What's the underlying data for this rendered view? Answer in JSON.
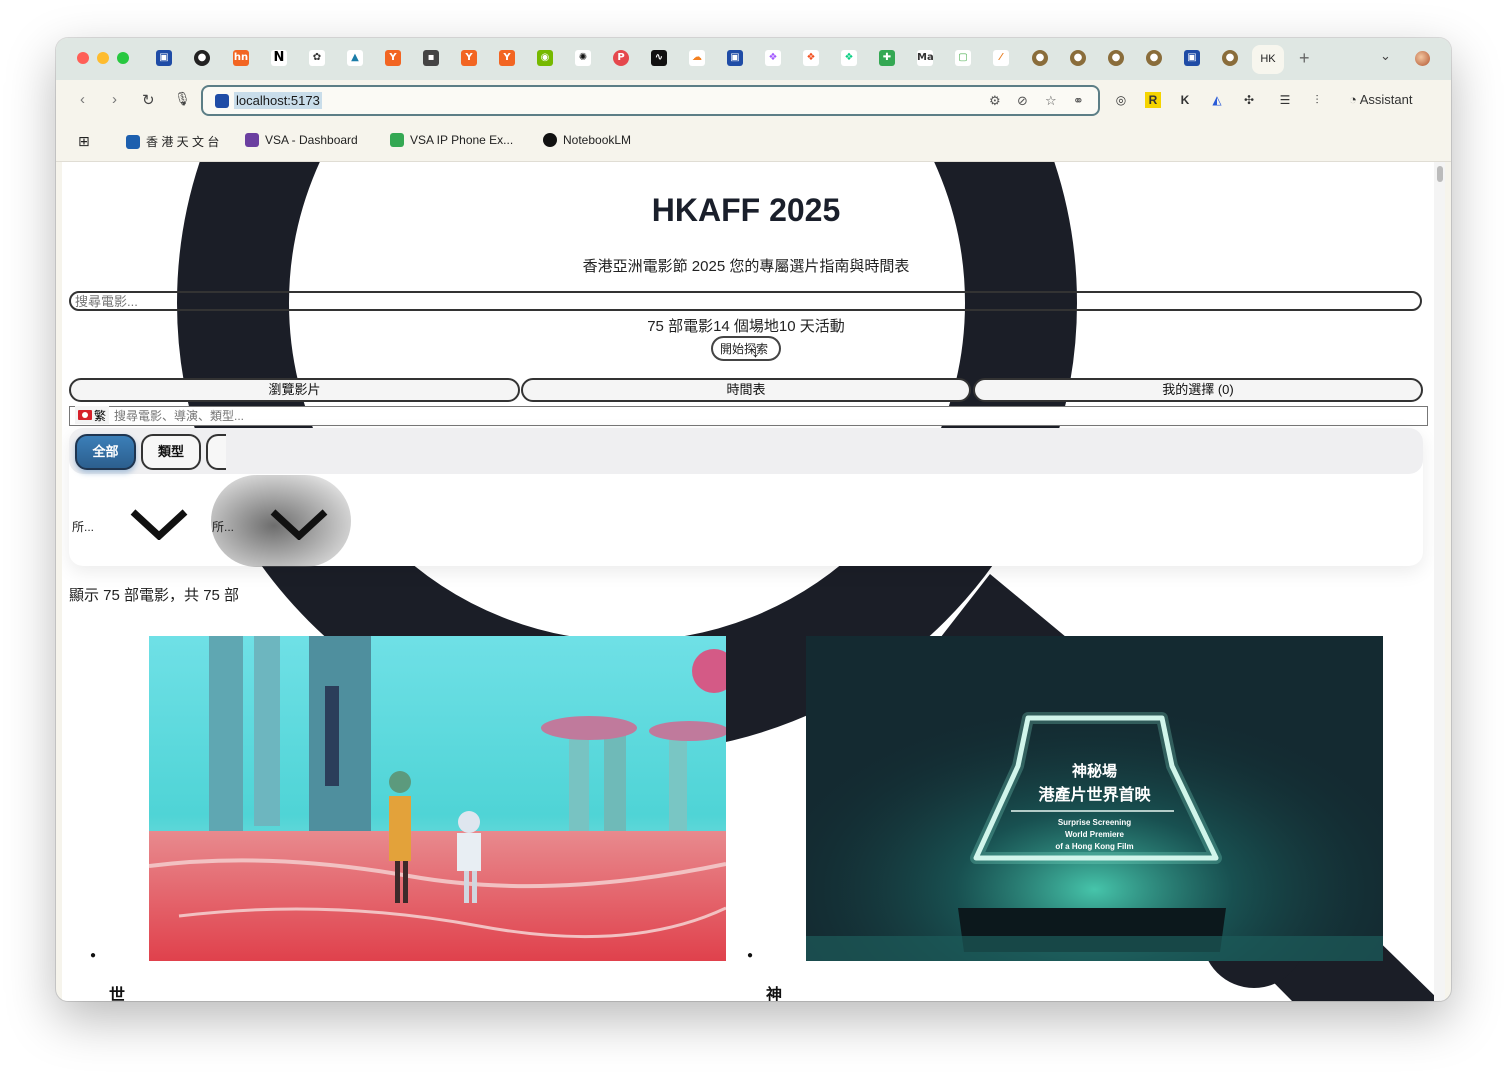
{
  "browser": {
    "active_tab_label": "HK",
    "url": "localhost:5173",
    "assistant_label": "Assistant",
    "bookmarks": [
      {
        "label": "香 港 天 文 台",
        "color": "#1d5fae"
      },
      {
        "label": "VSA - Dashboard",
        "color": "#6b3fa0"
      },
      {
        "label": "VSA IP Phone Ex...",
        "color": "#34a853"
      },
      {
        "label": "NotebookLM",
        "color": "#111111"
      }
    ]
  },
  "page": {
    "title": "HKAFF 2025",
    "subtitle": "香港亞洲電影節 2025 您的專屬選片指南與時間表",
    "search_placeholder": "搜尋電影...",
    "stats": "75 部電影14 個場地10 天活動",
    "explore_button": "開始探索",
    "explore_arrow": "↓",
    "nav_tabs": [
      "瀏覽影片",
      "時間表",
      "我的選擇 (0)"
    ],
    "lang_label": "繁",
    "filter_placeholder": "搜尋電影、導演、類型...",
    "chips": {
      "all": "全部",
      "type": "類型"
    },
    "selects": [
      "所...",
      "所..."
    ],
    "result_count": "顯示 75 部電影，共 75 部",
    "films": [
      {
        "title": "世外"
      },
      {
        "title": "神秘場",
        "poster_text_1": "神秘場",
        "poster_text_2": "港產片世界首映",
        "poster_en_1": "Surprise Screening",
        "poster_en_2": "World Premiere",
        "poster_en_3": "of a Hong Kong Film"
      }
    ]
  },
  "colors": {
    "lens_ring": "#1b1e27",
    "accent": "#2f6ea2",
    "omnibox_border": "#5c7e86"
  }
}
